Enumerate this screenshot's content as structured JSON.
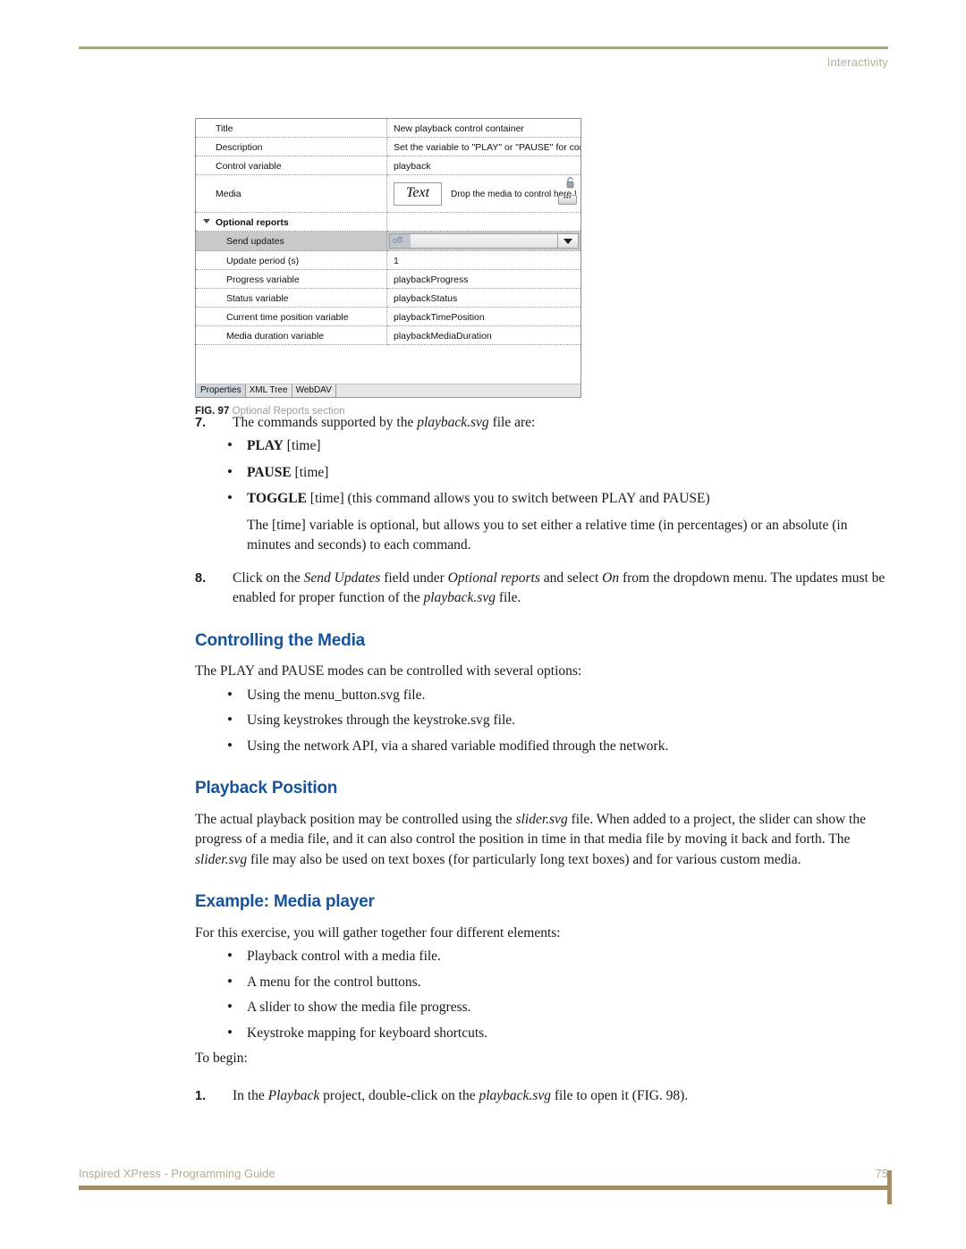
{
  "header": {
    "section_title": "Interactivity"
  },
  "figure": {
    "caption_label": "FIG. 97",
    "caption_text": "Optional Reports section",
    "panel": {
      "rows": [
        {
          "label": "Title",
          "value": "New playback control container"
        },
        {
          "label": "Description",
          "value": "Set the variable to \"PLAY\" or \"PAUSE\" for control"
        },
        {
          "label": "Control variable",
          "value": "playback"
        }
      ],
      "media_row": {
        "label": "Media",
        "thumb_text": "Text",
        "drop_hint": "Drop the media to control here !",
        "dots_label": "•••"
      },
      "group": {
        "label": "Optional reports"
      },
      "send_updates": {
        "label": "Send updates",
        "value": "off"
      },
      "optional_rows": [
        {
          "label": "Update period (s)",
          "value": "1"
        },
        {
          "label": "Progress variable",
          "value": "playbackProgress"
        },
        {
          "label": "Status variable",
          "value": "playbackStatus"
        },
        {
          "label": "Current time position variable",
          "value": "playbackTimePosition"
        },
        {
          "label": "Media duration variable",
          "value": "playbackMediaDuration"
        }
      ],
      "tabs": [
        {
          "label": "Properties",
          "active": true
        },
        {
          "label": "XML Tree",
          "active": false
        },
        {
          "label": "WebDAV",
          "active": false
        }
      ]
    }
  },
  "content": {
    "step7": {
      "number": "7.",
      "lead_a": "The commands supported by the ",
      "lead_file": "playback.svg",
      "lead_b": " file are:",
      "commands": [
        {
          "name": "PLAY",
          "rest": " [time]"
        },
        {
          "name": "PAUSE",
          "rest": " [time]"
        },
        {
          "name": "TOGGLE",
          "rest": " [time] (this command allows you to switch between PLAY and PAUSE)"
        }
      ],
      "note": "The [time] variable is optional, but allows you to set either a relative time (in percentages) or an absolute (in minutes and seconds) to each command."
    },
    "step8": {
      "number": "8.",
      "t1": "Click on the ",
      "i1": "Send Updates",
      "t2": " field under ",
      "i2": "Optional reports",
      "t3": " and select ",
      "i3": "On",
      "t4": " from the dropdown menu. The updates must be enabled for proper function of the ",
      "i4": "playback.svg",
      "t5": " file."
    },
    "controlling_media": {
      "heading": "Controlling the Media",
      "intro": "The PLAY and PAUSE modes can be controlled with several options:",
      "bullets": [
        "Using the menu_button.svg file.",
        "Using keystrokes through the keystroke.svg file.",
        "Using the network API, via a shared variable modified through the network."
      ]
    },
    "playback_position": {
      "heading": "Playback Position",
      "p1_a": "The actual playback position may be controlled using the ",
      "p1_i1": "slider.svg",
      "p1_b": " file. When added to a project, the slider can show the progress of a media file, and it can also control the position in time in that media file by moving it back and forth. The ",
      "p1_i2": "slider.svg",
      "p1_c": " file may also be used on text boxes (for particularly long text boxes) and for various custom media."
    },
    "example_media_player": {
      "heading": "Example: Media player",
      "intro": "For this exercise, you will gather together four different elements:",
      "bullets": [
        "Playback control with a media file.",
        "A menu for the control buttons.",
        "A slider to show the media file progress.",
        "Keystroke mapping for keyboard shortcuts."
      ],
      "to_begin": "To begin:",
      "step1": {
        "number": "1.",
        "t1": "In the ",
        "i1": "Playback",
        "t2": " project, double-click on the ",
        "i2": "playback.svg",
        "t3": " file to open it (FIG. 98)."
      }
    }
  },
  "footer": {
    "doc_title": "Inspired XPress - Programming Guide",
    "page_number": "75"
  }
}
